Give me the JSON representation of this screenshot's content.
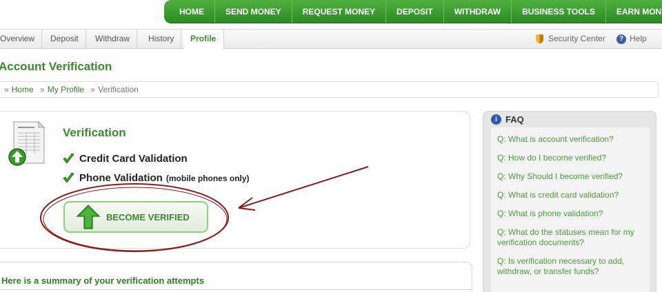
{
  "topnav": [
    "HOME",
    "SEND MONEY",
    "REQUEST MONEY",
    "DEPOSIT",
    "WITHDRAW",
    "BUSINESS TOOLS",
    "EARN MONEY"
  ],
  "subnav": {
    "tabs": [
      "Overview",
      "Deposit",
      "Withdraw",
      "History",
      "Profile"
    ],
    "active": "Profile",
    "security": "Security Center",
    "help": "Help"
  },
  "page_title": "Account Verification",
  "breadcrumb": [
    "Home",
    "My Profile",
    "Verification"
  ],
  "verification": {
    "title": "Verification",
    "items": [
      {
        "label": "Credit Card Validation",
        "note": ""
      },
      {
        "label": "Phone Validation",
        "note": "(mobile phones only)"
      }
    ],
    "button": "BECOME VERIFIED"
  },
  "summary": {
    "title": "Here is a summary of your verification attempts"
  },
  "faq": {
    "title": "FAQ",
    "questions": [
      "Q: What is account verification?",
      "Q: How do I become verified?",
      "Q: Why Should I become verified?",
      "Q: What is credit card validation?",
      "Q: What is phone validation?",
      "Q: What do the statuses mean for my verification documents?",
      "Q: Is verification necessary to add, withdraw, or transfer funds?"
    ]
  },
  "colors": {
    "brand_green": "#3a8a2c",
    "annotation": "#8b1a1a"
  }
}
